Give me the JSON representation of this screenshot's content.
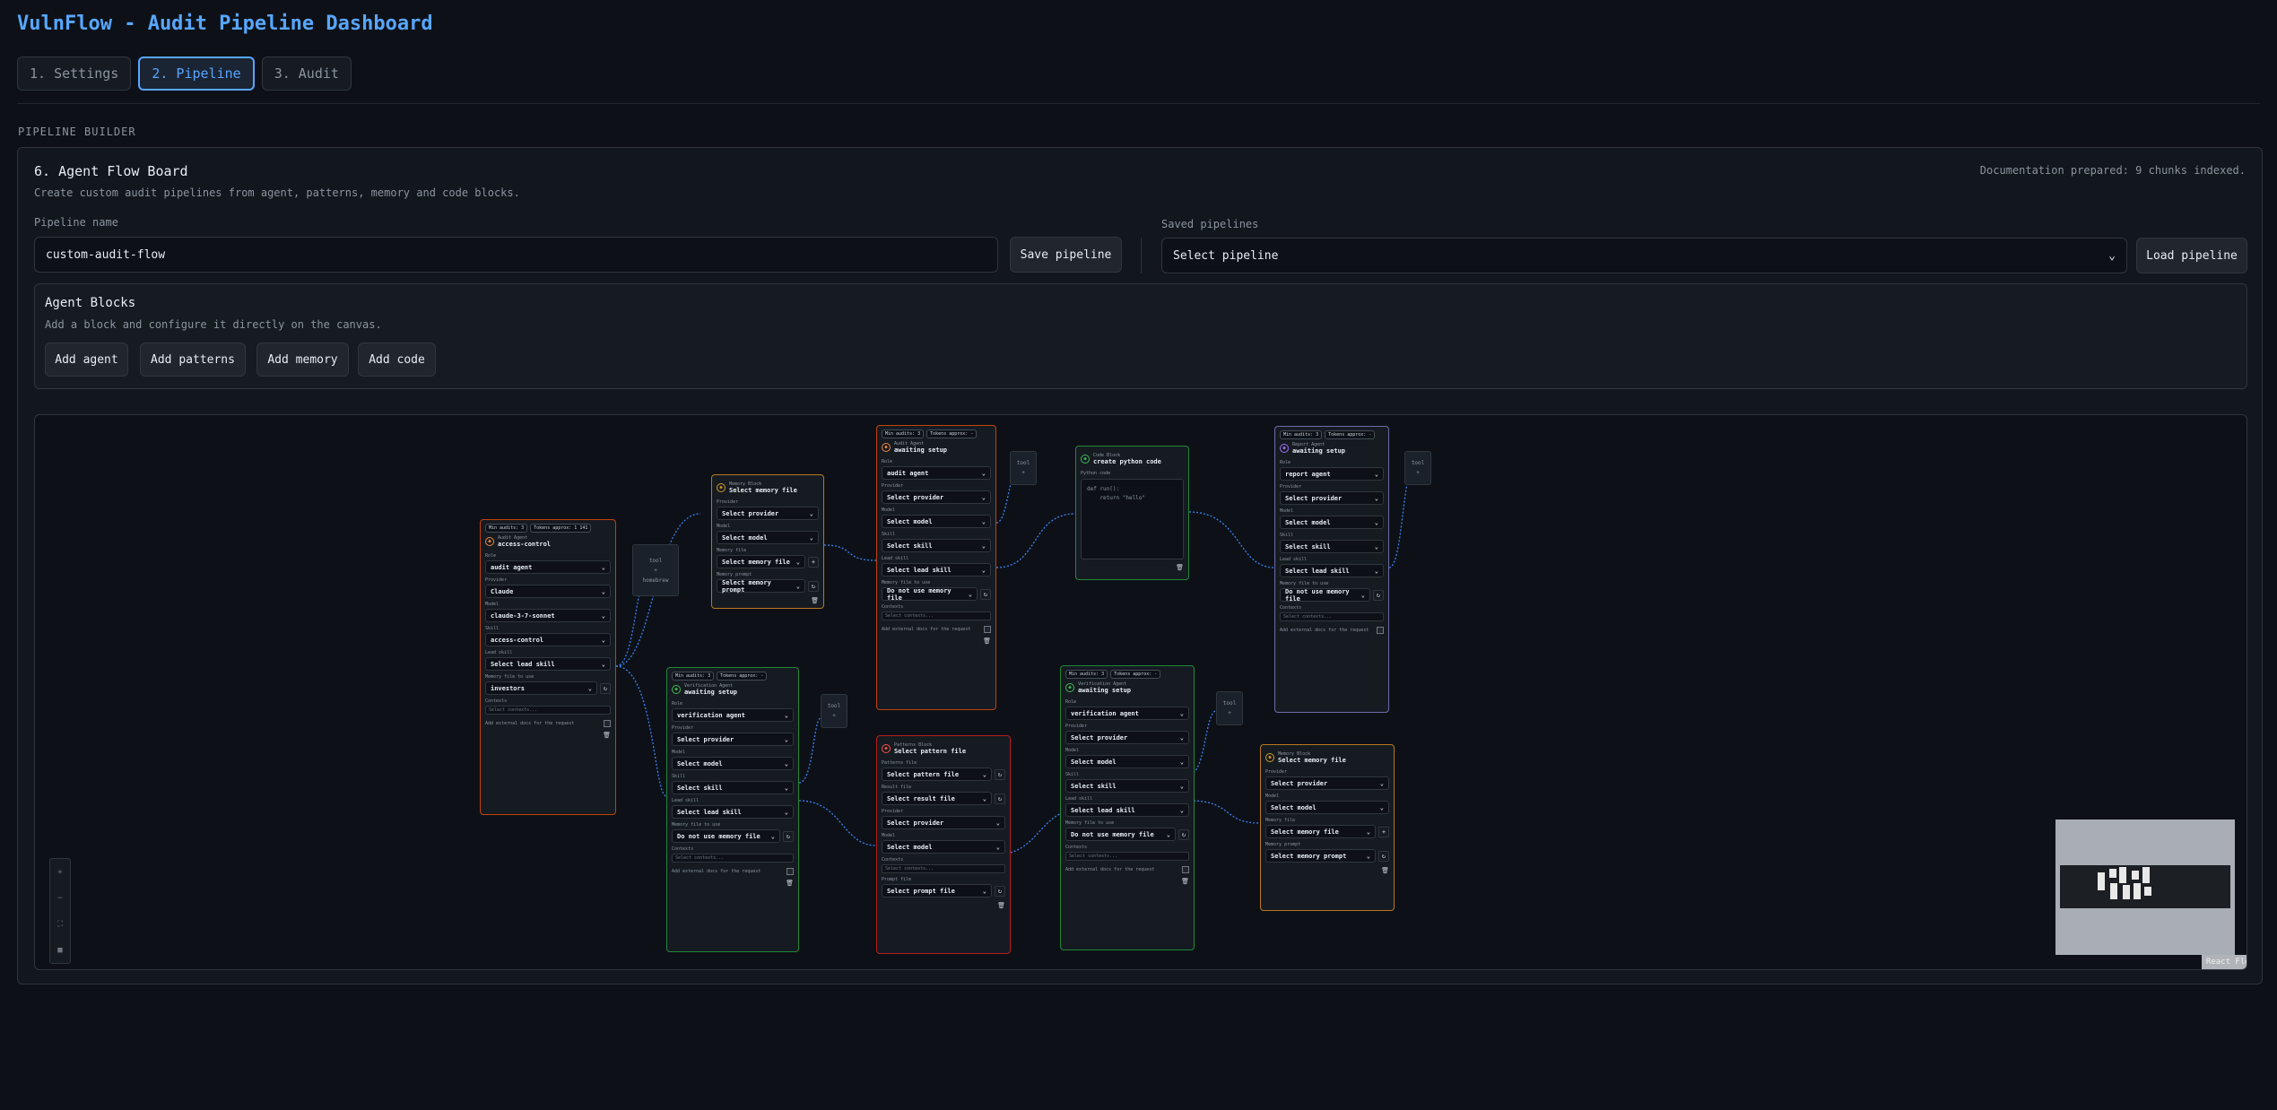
{
  "app": {
    "title": "VulnFlow - Audit Pipeline Dashboard"
  },
  "tabs": [
    {
      "label": "1. Settings",
      "active": false
    },
    {
      "label": "2. Pipeline",
      "active": true
    },
    {
      "label": "3. Audit",
      "active": false
    }
  ],
  "section_label": "PIPELINE BUILDER",
  "board": {
    "title": "6. Agent Flow Board",
    "description": "Create custom audit pipelines from agent, patterns, memory and code blocks.",
    "docs_status": "Documentation prepared: 9 chunks indexed.",
    "pipeline_name_label": "Pipeline name",
    "pipeline_name_value": "custom-audit-flow",
    "save_label": "Save pipeline",
    "saved_label": "Saved pipelines",
    "saved_selected": "Select pipeline",
    "load_label": "Load pipeline"
  },
  "agent_blocks": {
    "title": "Agent Blocks",
    "description": "Add a block and configure it directly on the canvas.",
    "buttons": [
      "Add agent",
      "Add patterns",
      "Add memory",
      "Add code"
    ]
  },
  "canvas": {
    "tools": [
      {
        "label": "tool",
        "value": "+",
        "extra": "homebrew"
      },
      {
        "label": "tool",
        "value": "+"
      },
      {
        "label": "tool",
        "value": "+"
      },
      {
        "label": "tool",
        "value": "+"
      },
      {
        "label": "tool",
        "value": "+"
      }
    ],
    "nodes": {
      "n1": {
        "chips": [
          "Min audits: 3",
          "Tokens approx: 1 141"
        ],
        "type": "Audit Agent",
        "name": "access-control",
        "fields": [
          {
            "label": "Role",
            "value": "audit agent"
          },
          {
            "label": "Provider",
            "value": "Claude"
          },
          {
            "label": "Model",
            "value": "claude-3-7-sonnet"
          },
          {
            "label": "Skill",
            "value": "access-control"
          },
          {
            "label": "Lead skill",
            "value": "Select lead skill"
          },
          {
            "label": "Memory file to use",
            "value": "investors"
          }
        ],
        "context_label": "Contexts",
        "context_placeholder": "Select contexts...",
        "checkbox_label": "Add external docs for the request"
      },
      "n2": {
        "type": "Memory Block",
        "name": "Select memory file",
        "fields": [
          {
            "label": "Provider",
            "value": "Select provider"
          },
          {
            "label": "Model",
            "value": "Select model"
          },
          {
            "label": "Memory file",
            "value": "Select memory file"
          },
          {
            "label": "Memory prompt",
            "value": "Select memory prompt"
          }
        ]
      },
      "n3": {
        "chips": [
          "Min audits: 3",
          "Tokens approx: -"
        ],
        "type": "Audit Agent",
        "name": "awaiting setup",
        "fields": [
          {
            "label": "Role",
            "value": "audit agent"
          },
          {
            "label": "Provider",
            "value": "Select provider"
          },
          {
            "label": "Model",
            "value": "Select model"
          },
          {
            "label": "Skill",
            "value": "Select skill"
          },
          {
            "label": "Lead skill",
            "value": "Select lead skill"
          },
          {
            "label": "Memory file to use",
            "value": "Do not use memory file"
          }
        ],
        "context_label": "Contexts",
        "context_placeholder": "Select contexts...",
        "checkbox_label": "Add external docs for the request"
      },
      "n4": {
        "type": "Code Block",
        "name": "create python code",
        "code_label": "Python code",
        "code": "def run():\n    return \"hello\""
      },
      "n5": {
        "chips": [
          "Min audits: 3",
          "Tokens approx: -"
        ],
        "type": "Report Agent",
        "name": "awaiting setup",
        "fields": [
          {
            "label": "Role",
            "value": "report agent"
          },
          {
            "label": "Provider",
            "value": "Select provider"
          },
          {
            "label": "Model",
            "value": "Select model"
          },
          {
            "label": "Skill",
            "value": "Select skill"
          },
          {
            "label": "Lead skill",
            "value": "Select lead skill"
          },
          {
            "label": "Memory file to use",
            "value": "Do not use memory file"
          }
        ],
        "context_label": "Contexts",
        "context_placeholder": "Select contexts...",
        "checkbox_label": "Add external docs for the request"
      },
      "n6": {
        "chips": [
          "Min audits: 3",
          "Tokens approx: -"
        ],
        "type": "Verification Agent",
        "name": "awaiting setup",
        "fields": [
          {
            "label": "Role",
            "value": "verification agent"
          },
          {
            "label": "Provider",
            "value": "Select provider"
          },
          {
            "label": "Model",
            "value": "Select model"
          },
          {
            "label": "Skill",
            "value": "Select skill"
          },
          {
            "label": "Lead skill",
            "value": "Select lead skill"
          },
          {
            "label": "Memory file to use",
            "value": "Do not use memory file"
          }
        ],
        "context_label": "Contexts",
        "context_placeholder": "Select contexts...",
        "checkbox_label": "Add external docs for the request"
      },
      "n7": {
        "type": "Patterns Block",
        "name": "Select pattern file",
        "fields": [
          {
            "label": "Patterns file",
            "value": "Select pattern file"
          },
          {
            "label": "Result file",
            "value": "Select result file"
          },
          {
            "label": "Provider",
            "value": "Select provider"
          },
          {
            "label": "Model",
            "value": "Select model"
          }
        ],
        "context_label": "Contexts",
        "context_placeholder": "Select contexts...",
        "prompt_label": "Prompt file",
        "prompt_value": "Select prompt file"
      },
      "n8": {
        "chips": [
          "Min audits: 3",
          "Tokens approx: -"
        ],
        "type": "Verification Agent",
        "name": "awaiting setup",
        "fields": [
          {
            "label": "Role",
            "value": "verification agent"
          },
          {
            "label": "Provider",
            "value": "Select provider"
          },
          {
            "label": "Model",
            "value": "Select model"
          },
          {
            "label": "Skill",
            "value": "Select skill"
          },
          {
            "label": "Lead skill",
            "value": "Select lead skill"
          },
          {
            "label": "Memory file to use",
            "value": "Do not use memory file"
          }
        ],
        "context_label": "Contexts",
        "context_placeholder": "Select contexts...",
        "checkbox_label": "Add external docs for the request"
      },
      "n9": {
        "type": "Memory Block",
        "name": "Select memory file",
        "fields": [
          {
            "label": "Provider",
            "value": "Select provider"
          },
          {
            "label": "Model",
            "value": "Select model"
          },
          {
            "label": "Memory file",
            "value": "Select memory file"
          },
          {
            "label": "Memory prompt",
            "value": "Select memory prompt"
          }
        ]
      }
    },
    "attribution": "React Flow"
  },
  "colors": {
    "accent": "#58a6ff",
    "background": "#0d1117",
    "edge": "#3b82f6",
    "audit_border": "#c2410c",
    "memory_border": "#b7791f",
    "verification_border": "#22863a",
    "patterns_border": "#b91c1c",
    "report_border": "#6e6ba8"
  }
}
